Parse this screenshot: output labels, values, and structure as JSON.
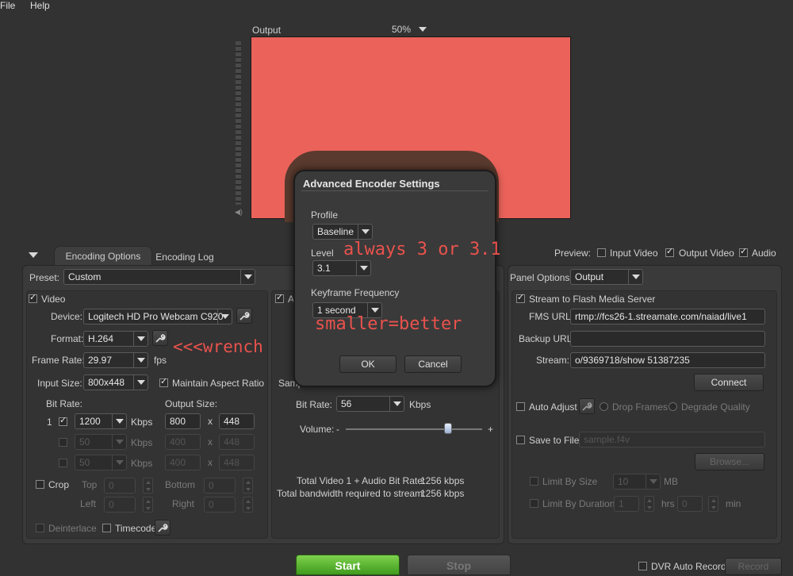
{
  "menu": {
    "file": "File",
    "help": "Help"
  },
  "preview": {
    "output_label": "Output",
    "zoom": "50%",
    "fill_color": "#ea625a"
  },
  "tabs": {
    "encoding_options": "Encoding Options",
    "encoding_log": "Encoding Log"
  },
  "preview_options": {
    "label": "Preview:",
    "input_video": "Input Video",
    "output_video": "Output Video",
    "audio": "Audio"
  },
  "preset": {
    "label": "Preset:",
    "value": "Custom"
  },
  "video": {
    "section": "Video",
    "device_label": "Device:",
    "device": "Logitech HD Pro Webcam C920",
    "format_label": "Format:",
    "format": "H.264",
    "frame_rate_label": "Frame Rate:",
    "frame_rate": "29.97",
    "fps": "fps",
    "input_size_label": "Input Size:",
    "input_size": "800x448",
    "maintain_aspect": "Maintain Aspect Ratio",
    "bit_rate_label": "Bit Rate:",
    "output_size_label": "Output Size:",
    "rows": [
      {
        "num": "1",
        "bitrate": "1200",
        "kbps": "Kbps",
        "w": "800",
        "x": "x",
        "h": "448"
      },
      {
        "num": "",
        "bitrate": "50",
        "kbps": "Kbps",
        "w": "400",
        "x": "x",
        "h": "448"
      },
      {
        "num": "",
        "bitrate": "50",
        "kbps": "Kbps",
        "w": "400",
        "x": "x",
        "h": "448"
      }
    ],
    "crop": "Crop",
    "top": "Top",
    "bottom": "Bottom",
    "left": "Left",
    "right": "Right",
    "crop_top": "0",
    "crop_bottom": "0",
    "crop_left": "0",
    "crop_right": "0",
    "deinterlace": "Deinterlace",
    "timecode": "Timecode"
  },
  "audio": {
    "samp_partial": "Samp",
    "bit_rate_label": "Bit Rate:",
    "bit_rate": "56",
    "kbps": "Kbps",
    "volume_label": "Volume:",
    "minus": "-",
    "plus": "+",
    "volume_level": 0.75,
    "total_label": "Total Video 1 + Audio Bit Rate:",
    "total_value": "1256 kbps",
    "bandwidth_label": "Total bandwidth required to stream:",
    "bandwidth_value": "1256 kbps",
    "section_partial": "A"
  },
  "panel_options": {
    "label": "Panel Options:",
    "value": "Output"
  },
  "stream": {
    "section": "Stream to Flash Media Server",
    "fms_label": "FMS URL:",
    "fms_url": "rtmp://fcs26-1.streamate.com/naiad/live1",
    "backup_label": "Backup URL:",
    "backup_url": "",
    "stream_label": "Stream:",
    "stream_value": "o/9369718/show  51387235",
    "connect": "Connect",
    "auto_adjust": "Auto Adjust",
    "drop_frames": "Drop Frames",
    "degrade_quality": "Degrade Quality",
    "save_to_file": "Save to File",
    "file_name": "sample.f4v",
    "browse": "Browse...",
    "limit_size": "Limit By Size",
    "limit_size_value": "10",
    "mb": "MB",
    "limit_duration": "Limit By Duration",
    "hrs_value": "1",
    "hrs": "hrs",
    "min_value": "0",
    "min": "min"
  },
  "controls": {
    "start": "Start",
    "stop": "Stop",
    "dvr_auto_record": "DVR Auto Record",
    "record": "Record"
  },
  "dialog": {
    "title": "Advanced Encoder Settings",
    "profile_label": "Profile",
    "profile": "Baseline",
    "level_label": "Level",
    "level": "3.1",
    "keyframe_label": "Keyframe Frequency",
    "keyframe": "1 second",
    "ok": "OK",
    "cancel": "Cancel"
  },
  "annotations": {
    "level_note": "always 3 or 3.1",
    "keyframe_note": "smaller=better",
    "wrench_note": "<<<wrench",
    "color": "#e9524d"
  }
}
